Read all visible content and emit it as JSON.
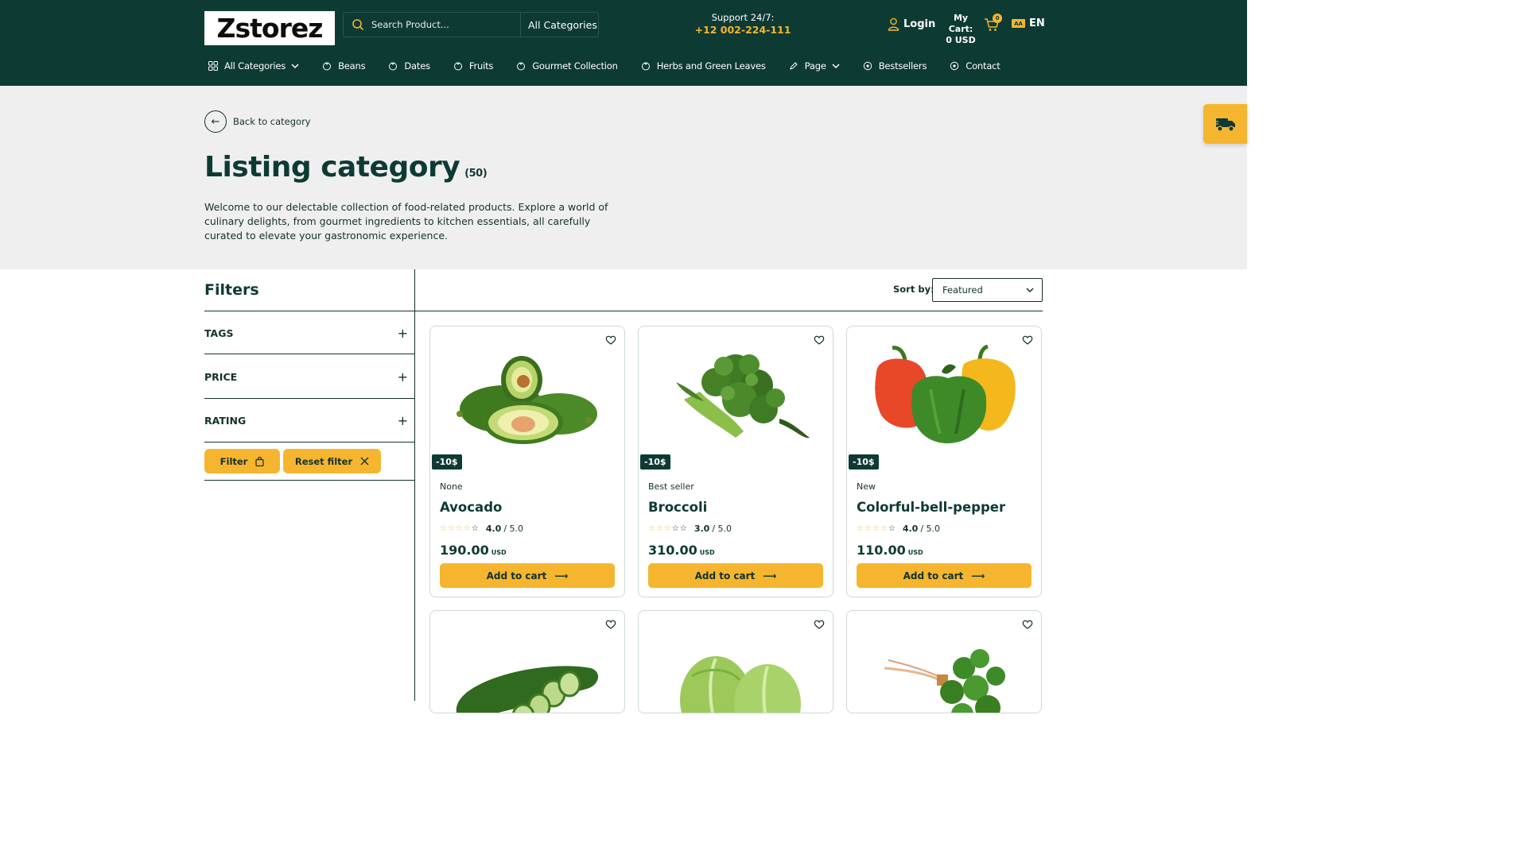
{
  "header": {
    "logo": "Zstorez",
    "search_placeholder": "Search Product...",
    "search_category": "All Categories",
    "support_label": "Support 24/7:",
    "support_phone": "+12 002-224-111",
    "login": "Login",
    "cart_label": "My Cart:",
    "cart_total": "0 USD",
    "cart_count": "0",
    "lang": "EN",
    "lang_icon_text": "AA"
  },
  "nav": [
    {
      "label": "All Categories",
      "icon": "grid-icon",
      "dropdown": true
    },
    {
      "label": "Beans",
      "icon": "basket-icon"
    },
    {
      "label": "Dates",
      "icon": "basket-icon"
    },
    {
      "label": "Fruits",
      "icon": "basket-icon"
    },
    {
      "label": "Gourmet Collection",
      "icon": "basket-icon"
    },
    {
      "label": "Herbs and Green Leaves",
      "icon": "basket-icon"
    },
    {
      "label": "Page",
      "icon": "pen-icon",
      "dropdown": true
    },
    {
      "label": "Bestsellers",
      "icon": "circle-icon"
    },
    {
      "label": "Contact",
      "icon": "circle-icon"
    }
  ],
  "hero": {
    "back_label": "Back to category",
    "title": "Listing category",
    "count": "(50)",
    "description": "Welcome to our delectable collection of food-related products. Explore a world of culinary delights, from gourmet ingredients to kitchen essentials, all carefully curated to elevate your gastronomic experience."
  },
  "filters": {
    "title": "Filters",
    "facets": [
      "TAGS",
      "PRICE",
      "RATING"
    ],
    "filter_btn": "Filter",
    "reset_btn": "Reset filter"
  },
  "sort": {
    "label": "Sort by:",
    "value": "Featured"
  },
  "products": [
    {
      "discount": "-10$",
      "tag": "None",
      "name": "Avocado",
      "rating": "4.0",
      "rating_max": "/ 5.0",
      "price": "190.00",
      "currency": "USD",
      "cta": "Add to cart"
    },
    {
      "discount": "-10$",
      "tag": "Best seller",
      "name": "Broccoli",
      "rating": "3.0",
      "rating_max": "/ 5.0",
      "price": "310.00",
      "currency": "USD",
      "cta": "Add to cart"
    },
    {
      "discount": "-10$",
      "tag": "New",
      "name": "Colorful-bell-pepper",
      "rating": "4.0",
      "rating_max": "/ 5.0",
      "price": "110.00",
      "currency": "USD",
      "cta": "Add to cart"
    }
  ],
  "colors": {
    "header_bg": "#0e3a34",
    "accent": "#f6b52e",
    "hero_bg": "#efefef"
  }
}
